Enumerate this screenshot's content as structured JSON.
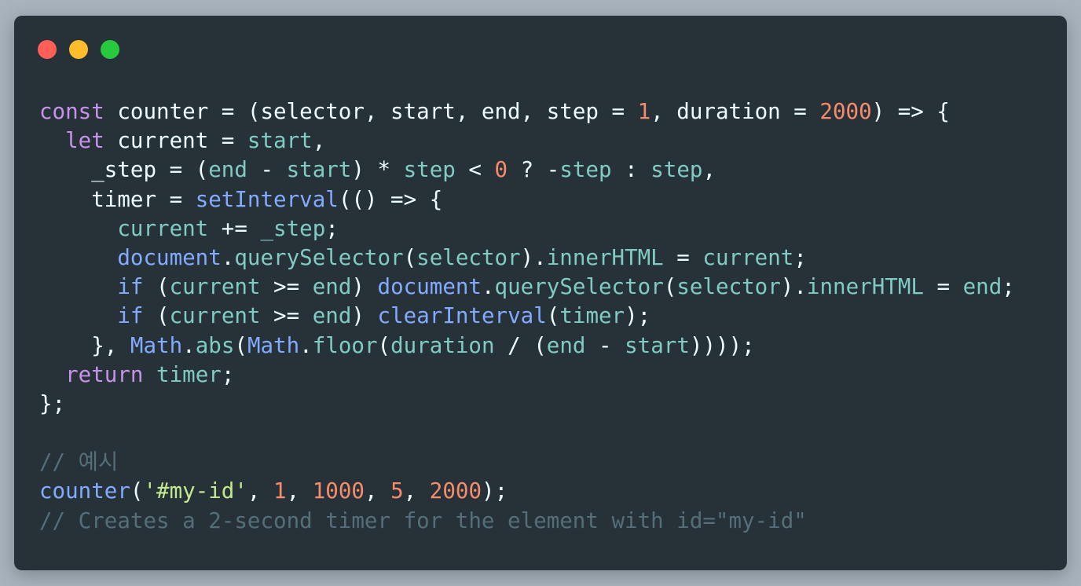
{
  "window": {
    "controls": [
      "close",
      "minimize",
      "maximize"
    ]
  },
  "colors": {
    "background": "#a9b3bd",
    "editor": "#263238",
    "keyword": "#c792ea",
    "function": "#82aaff",
    "identifier": "#80cbc4",
    "number": "#f78c6c",
    "string": "#c3e88d",
    "comment": "#546e7a",
    "plain": "#eeffff"
  },
  "code": {
    "lines": [
      [
        [
          "k",
          "const"
        ],
        [
          "p",
          " counter = (selector, start, end, step = "
        ],
        [
          "n",
          "1"
        ],
        [
          "p",
          ", duration = "
        ],
        [
          "n",
          "2000"
        ],
        [
          "p",
          ") => {"
        ]
      ],
      [
        [
          "p",
          "  "
        ],
        [
          "k",
          "let"
        ],
        [
          "p",
          " current = "
        ],
        [
          "i",
          "start"
        ],
        [
          "p",
          ","
        ]
      ],
      [
        [
          "p",
          "    _step = ("
        ],
        [
          "i",
          "end"
        ],
        [
          "p",
          " - "
        ],
        [
          "i",
          "start"
        ],
        [
          "p",
          ") * "
        ],
        [
          "i",
          "step"
        ],
        [
          "p",
          " < "
        ],
        [
          "n",
          "0"
        ],
        [
          "p",
          " ? -"
        ],
        [
          "i",
          "step"
        ],
        [
          "p",
          " : "
        ],
        [
          "i",
          "step"
        ],
        [
          "p",
          ","
        ]
      ],
      [
        [
          "p",
          "    timer = "
        ],
        [
          "f",
          "setInterval"
        ],
        [
          "p",
          "(() => {"
        ]
      ],
      [
        [
          "p",
          "      "
        ],
        [
          "i",
          "current"
        ],
        [
          "p",
          " += "
        ],
        [
          "i",
          "_step"
        ],
        [
          "p",
          ";"
        ]
      ],
      [
        [
          "p",
          "      "
        ],
        [
          "f",
          "document"
        ],
        [
          "p",
          "."
        ],
        [
          "i",
          "querySelector"
        ],
        [
          "p",
          "("
        ],
        [
          "i",
          "selector"
        ],
        [
          "p",
          ")."
        ],
        [
          "i",
          "innerHTML"
        ],
        [
          "p",
          " = "
        ],
        [
          "i",
          "current"
        ],
        [
          "p",
          ";"
        ]
      ],
      [
        [
          "p",
          "      "
        ],
        [
          "f",
          "if"
        ],
        [
          "p",
          " ("
        ],
        [
          "i",
          "current"
        ],
        [
          "p",
          " >= "
        ],
        [
          "i",
          "end"
        ],
        [
          "p",
          ") "
        ],
        [
          "f",
          "document"
        ],
        [
          "p",
          "."
        ],
        [
          "i",
          "querySelector"
        ],
        [
          "p",
          "("
        ],
        [
          "i",
          "selector"
        ],
        [
          "p",
          ")."
        ],
        [
          "i",
          "innerHTML"
        ],
        [
          "p",
          " = "
        ],
        [
          "i",
          "end"
        ],
        [
          "p",
          ";"
        ]
      ],
      [
        [
          "p",
          "      "
        ],
        [
          "f",
          "if"
        ],
        [
          "p",
          " ("
        ],
        [
          "i",
          "current"
        ],
        [
          "p",
          " >= "
        ],
        [
          "i",
          "end"
        ],
        [
          "p",
          ") "
        ],
        [
          "f",
          "clearInterval"
        ],
        [
          "p",
          "("
        ],
        [
          "i",
          "timer"
        ],
        [
          "p",
          ");"
        ]
      ],
      [
        [
          "p",
          "    }, "
        ],
        [
          "f",
          "Math"
        ],
        [
          "p",
          "."
        ],
        [
          "i",
          "abs"
        ],
        [
          "p",
          "("
        ],
        [
          "f",
          "Math"
        ],
        [
          "p",
          "."
        ],
        [
          "i",
          "floor"
        ],
        [
          "p",
          "("
        ],
        [
          "i",
          "duration"
        ],
        [
          "p",
          " / ("
        ],
        [
          "i",
          "end"
        ],
        [
          "p",
          " - "
        ],
        [
          "i",
          "start"
        ],
        [
          "p",
          "))));"
        ]
      ],
      [
        [
          "p",
          "  "
        ],
        [
          "k",
          "return"
        ],
        [
          "p",
          " "
        ],
        [
          "i",
          "timer"
        ],
        [
          "p",
          ";"
        ]
      ],
      [
        [
          "p",
          "};"
        ]
      ],
      [],
      [
        [
          "c",
          "// 예시"
        ]
      ],
      [
        [
          "f",
          "counter"
        ],
        [
          "p",
          "("
        ],
        [
          "s",
          "'#my-id'"
        ],
        [
          "p",
          ", "
        ],
        [
          "n",
          "1"
        ],
        [
          "p",
          ", "
        ],
        [
          "n",
          "1000"
        ],
        [
          "p",
          ", "
        ],
        [
          "n",
          "5"
        ],
        [
          "p",
          ", "
        ],
        [
          "n",
          "2000"
        ],
        [
          "p",
          ");"
        ]
      ],
      [
        [
          "c",
          "// Creates a 2-second timer for the element with id=\"my-id\""
        ]
      ]
    ]
  }
}
